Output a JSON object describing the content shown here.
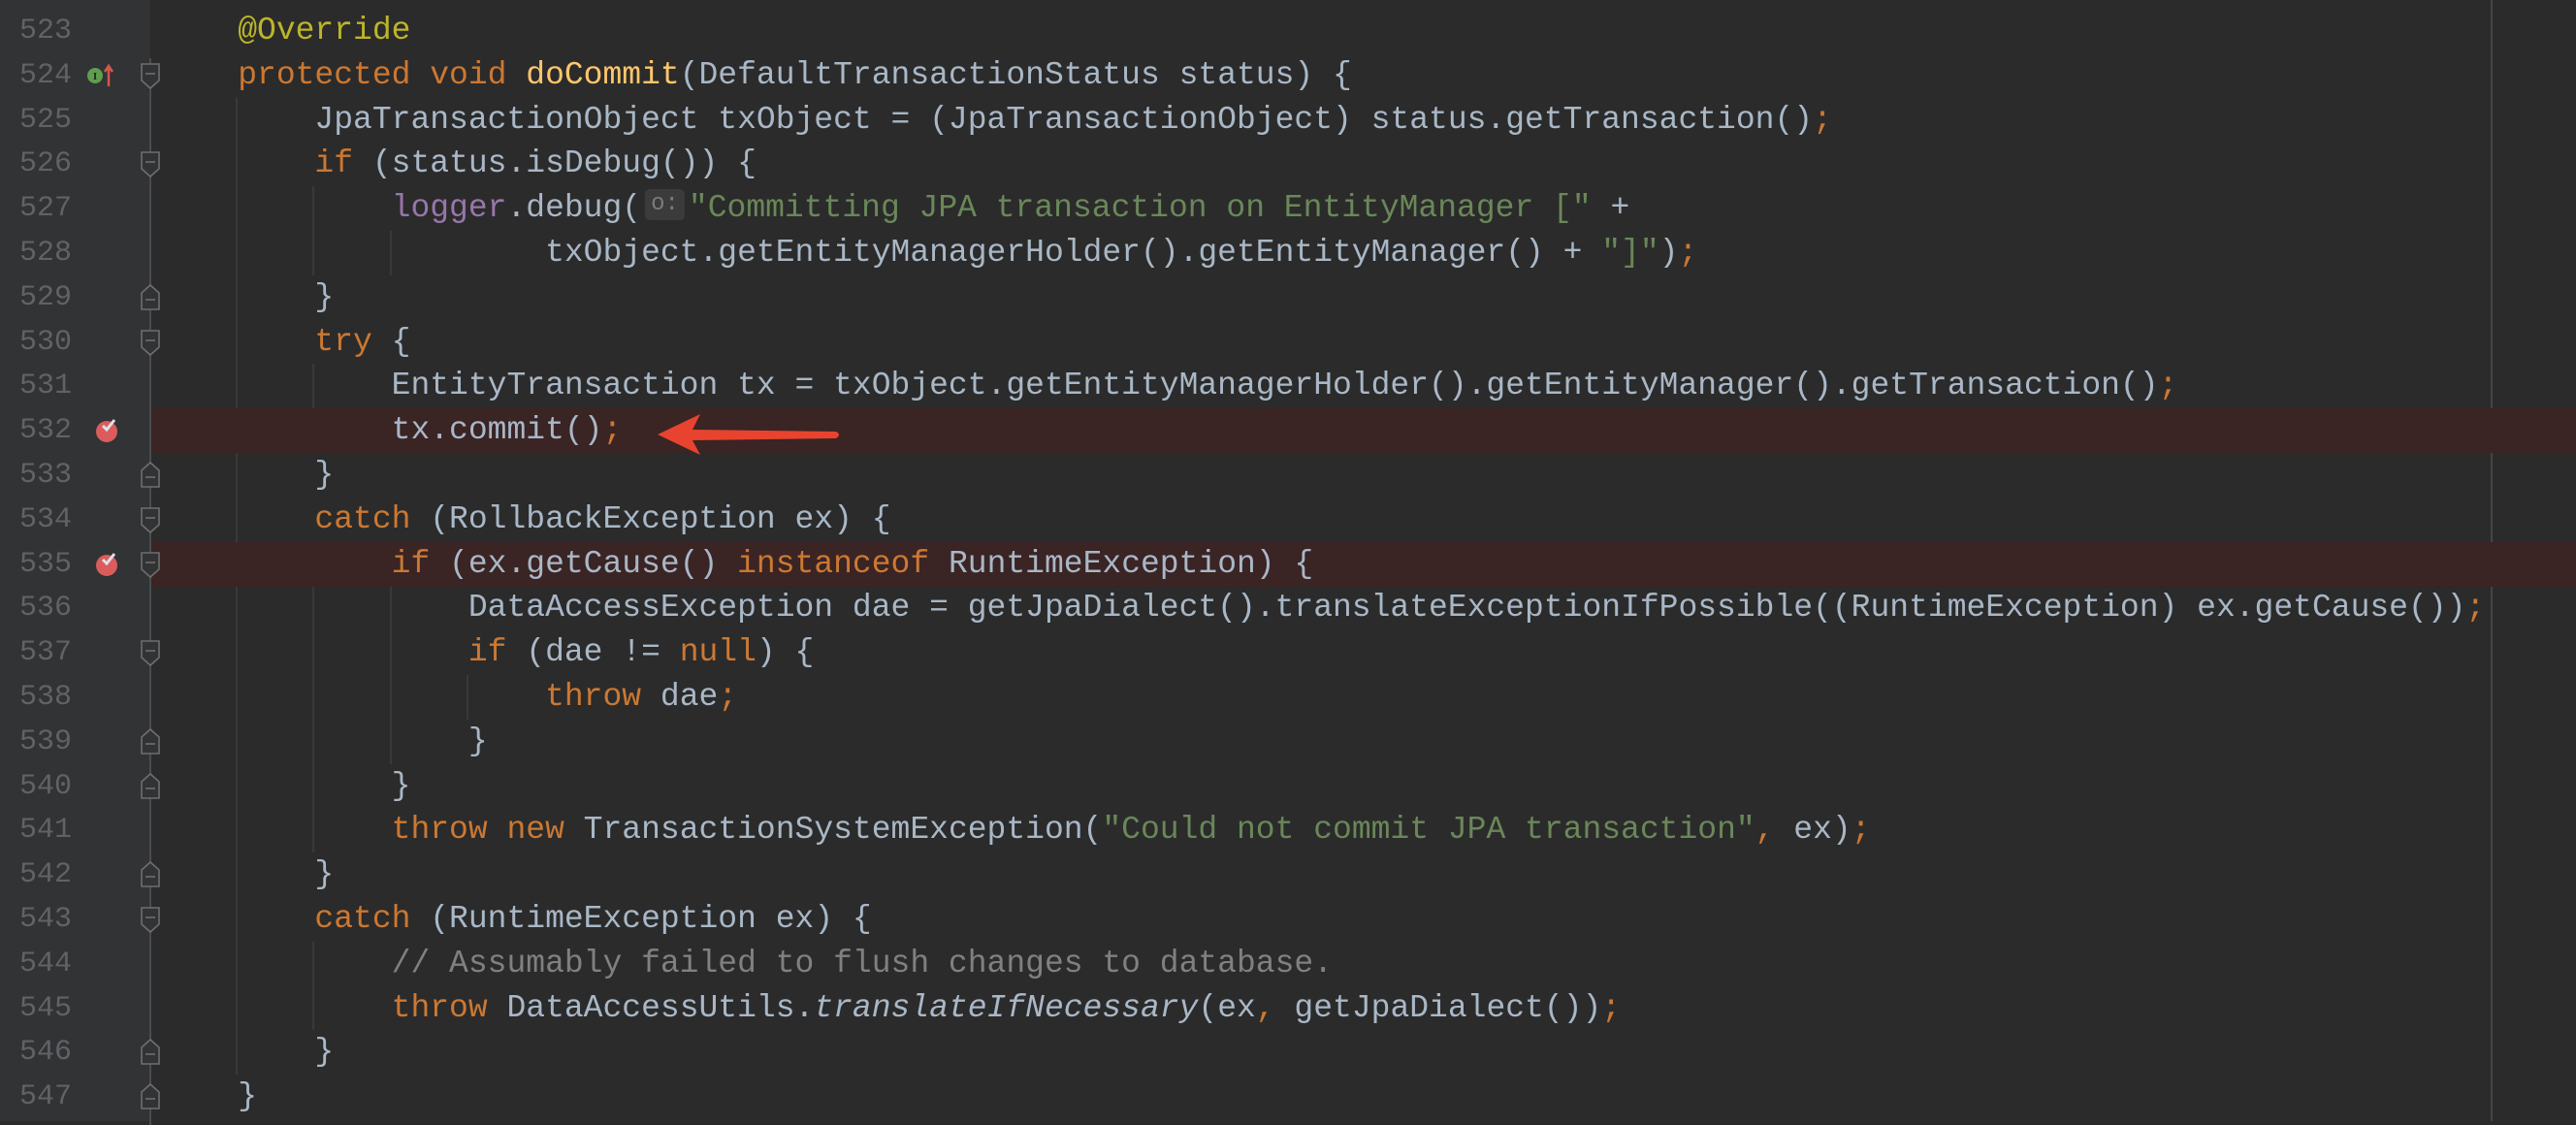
{
  "editor": {
    "first_line": 523,
    "colors": {
      "background": "#2b2b2b",
      "gutter": "#313335",
      "keyword": "#cc7832",
      "string": "#6a8759",
      "annotation": "#bbb529",
      "method_declaration": "#ffc66d",
      "field": "#9876aa",
      "comment": "#808080",
      "text": "#a9b7c6",
      "breakpoint_line": "#3a2424",
      "arrow": "#e8432e"
    },
    "lines": [
      {
        "n": "523",
        "segs": [
          [
            "    @Override",
            "ann"
          ]
        ]
      },
      {
        "n": "524",
        "icon": "implements-override",
        "fold": "start",
        "segs": [
          [
            "    protected void ",
            "kw"
          ],
          [
            "doCommit",
            "fn"
          ],
          [
            "(DefaultTransactionStatus status) {",
            ""
          ]
        ]
      },
      {
        "n": "525",
        "segs": [
          [
            "        JpaTransactionObject txObject = (JpaTransactionObject) status.getTransaction()",
            ""
          ],
          [
            ";",
            "kw"
          ]
        ]
      },
      {
        "n": "526",
        "fold": "start",
        "segs": [
          [
            "        if",
            "kw"
          ],
          [
            " (status.isDebug()) {",
            ""
          ]
        ]
      },
      {
        "n": "527",
        "segs": [
          [
            "            ",
            ""
          ],
          [
            "logger",
            "fld"
          ],
          [
            ".debug(",
            ""
          ],
          [
            "o:",
            "hint"
          ],
          [
            "\"Committing JPA transaction on EntityManager [\"",
            "str"
          ],
          [
            " +",
            ""
          ]
        ]
      },
      {
        "n": "528",
        "segs": [
          [
            "                    txObject.getEntityManagerHolder().getEntityManager() + ",
            ""
          ],
          [
            "\"]\"",
            "str"
          ],
          [
            ")",
            ""
          ],
          [
            ";",
            "kw"
          ]
        ]
      },
      {
        "n": "529",
        "fold": "end",
        "segs": [
          [
            "        }",
            ""
          ]
        ]
      },
      {
        "n": "530",
        "fold": "start",
        "segs": [
          [
            "        try",
            "kw"
          ],
          [
            " {",
            ""
          ]
        ]
      },
      {
        "n": "531",
        "segs": [
          [
            "            EntityTransaction tx = txObject.getEntityManagerHolder().getEntityManager().getTransaction()",
            ""
          ],
          [
            ";",
            "kw"
          ]
        ]
      },
      {
        "n": "532",
        "breakpoint": true,
        "segs": [
          [
            "            tx.commit()",
            ""
          ],
          [
            ";",
            "kw"
          ]
        ]
      },
      {
        "n": "533",
        "fold": "end",
        "segs": [
          [
            "        }",
            ""
          ]
        ]
      },
      {
        "n": "534",
        "fold": "start",
        "segs": [
          [
            "        catch",
            "kw"
          ],
          [
            " (RollbackException ex) {",
            ""
          ]
        ]
      },
      {
        "n": "535",
        "breakpoint": true,
        "fold": "start",
        "segs": [
          [
            "            if",
            "kw"
          ],
          [
            " (ex.getCause() ",
            ""
          ],
          [
            "instanceof",
            "kw"
          ],
          [
            " RuntimeException) {",
            ""
          ]
        ]
      },
      {
        "n": "536",
        "segs": [
          [
            "                DataAccessException dae = getJpaDialect().translateExceptionIfPossible((RuntimeException) ex.getCause())",
            ""
          ],
          [
            ";",
            "kw"
          ]
        ]
      },
      {
        "n": "537",
        "fold": "start",
        "segs": [
          [
            "                if",
            "kw"
          ],
          [
            " (dae != ",
            ""
          ],
          [
            "null",
            "kw"
          ],
          [
            ") {",
            ""
          ]
        ]
      },
      {
        "n": "538",
        "segs": [
          [
            "                    throw",
            "kw"
          ],
          [
            " dae",
            ""
          ],
          [
            ";",
            "kw"
          ]
        ]
      },
      {
        "n": "539",
        "fold": "end",
        "segs": [
          [
            "                }",
            ""
          ]
        ]
      },
      {
        "n": "540",
        "fold": "end",
        "segs": [
          [
            "            }",
            ""
          ]
        ]
      },
      {
        "n": "541",
        "segs": [
          [
            "            throw new",
            "kw"
          ],
          [
            " TransactionSystemException(",
            ""
          ],
          [
            "\"Could not commit JPA transaction\"",
            "str"
          ],
          [
            ",",
            "kw"
          ],
          [
            " ex)",
            ""
          ],
          [
            ";",
            "kw"
          ]
        ]
      },
      {
        "n": "542",
        "fold": "end",
        "segs": [
          [
            "        }",
            ""
          ]
        ]
      },
      {
        "n": "543",
        "fold": "start",
        "segs": [
          [
            "        catch",
            "kw"
          ],
          [
            " (RuntimeException ex) {",
            ""
          ]
        ]
      },
      {
        "n": "544",
        "segs": [
          [
            "            // Assumably failed to flush changes to database.",
            "cmt"
          ]
        ]
      },
      {
        "n": "545",
        "segs": [
          [
            "            throw",
            "kw"
          ],
          [
            " DataAccessUtils.",
            ""
          ],
          [
            "translateIfNecessary",
            "it"
          ],
          [
            "(ex",
            ""
          ],
          [
            ",",
            "kw"
          ],
          [
            " getJpaDialect())",
            ""
          ],
          [
            ";",
            "kw"
          ]
        ]
      },
      {
        "n": "546",
        "fold": "end",
        "segs": [
          [
            "        }",
            ""
          ]
        ]
      },
      {
        "n": "547",
        "fold": "end",
        "segs": [
          [
            "    }",
            ""
          ]
        ]
      }
    ],
    "annotation_arrow": {
      "points_to_line": "532",
      "icon": "red-arrow-left"
    }
  }
}
